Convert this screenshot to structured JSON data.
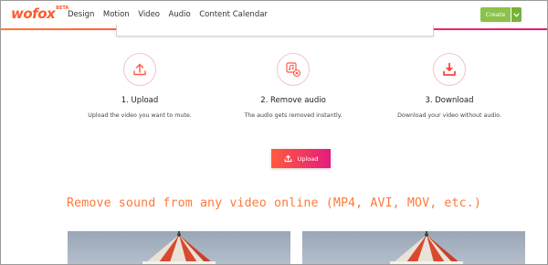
{
  "header": {
    "logo_text": "wofox",
    "logo_sup": "BETA",
    "nav": [
      "Design",
      "Motion",
      "Video",
      "Audio",
      "Content Calendar"
    ],
    "create_label": "Create"
  },
  "steps": [
    {
      "title": "1. Upload",
      "desc": "Upload the video you want to mute.",
      "icon": "upload-icon"
    },
    {
      "title": "2. Remove audio",
      "desc": "The audio gets removed instantly.",
      "icon": "remove-audio-icon"
    },
    {
      "title": "3. Download",
      "desc": "Download your video without audio.",
      "icon": "download-icon"
    }
  ],
  "upload_button": {
    "label": "Upload",
    "icon": "upload-icon"
  },
  "heading": "Remove sound from any video online (MP4, AVI, MOV, etc.)",
  "colors": {
    "accent_orange": "#ff7a3a",
    "gradient_start": "#ff5a3c",
    "gradient_end": "#e41d7e",
    "create_green": "#8ac24a"
  }
}
